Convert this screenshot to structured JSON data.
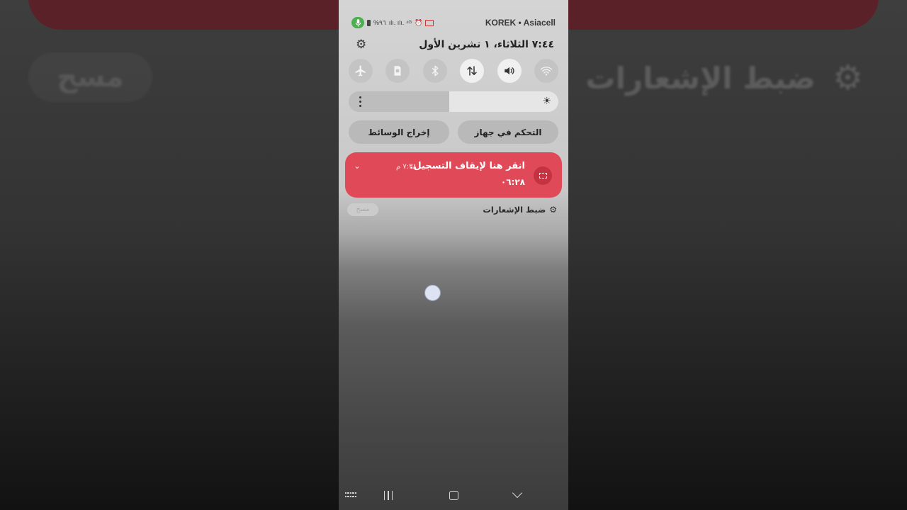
{
  "status_bar": {
    "carrier": "KOREK • Asiacell",
    "battery_text": "%٩٦",
    "signal_text": "ılı. ılı. ⁴ᴳ",
    "recording_indicator": "mic-icon",
    "recording_color": "#4caf50"
  },
  "header": {
    "datetime": "٧:٤٤ الثلاثاء، ١ تشرين الأول",
    "settings_icon": "gear-icon"
  },
  "quick_settings": [
    {
      "name": "airplane-mode",
      "icon": "airplane-icon",
      "active": false
    },
    {
      "name": "storage",
      "icon": "storage-icon",
      "active": false
    },
    {
      "name": "bluetooth",
      "icon": "bluetooth-icon",
      "active": false
    },
    {
      "name": "mobile-data",
      "icon": "data-transfer-icon",
      "active": true
    },
    {
      "name": "sound",
      "icon": "speaker-icon",
      "active": true
    },
    {
      "name": "wifi",
      "icon": "wifi-icon",
      "active": false
    }
  ],
  "brightness": {
    "level": 0.52,
    "icon": "sun-icon"
  },
  "panel_buttons": {
    "device_control": "التحكم في جهاز",
    "media_output": "إخراج الوسائط"
  },
  "notification": {
    "title": "انقر هنا لإيقاف التسجيل.",
    "time": "٧:٣٨ م",
    "body": "٠٦:٢٨",
    "color": "#e04958",
    "icon": "screen-record-icon"
  },
  "notification_footer": {
    "settings_label": "ضبط الإشعارات",
    "clear_label": "مسح"
  },
  "nav": {
    "keyboard": "keyboard-icon",
    "recents": "recents-icon",
    "home": "home-icon",
    "back": "back-icon"
  }
}
